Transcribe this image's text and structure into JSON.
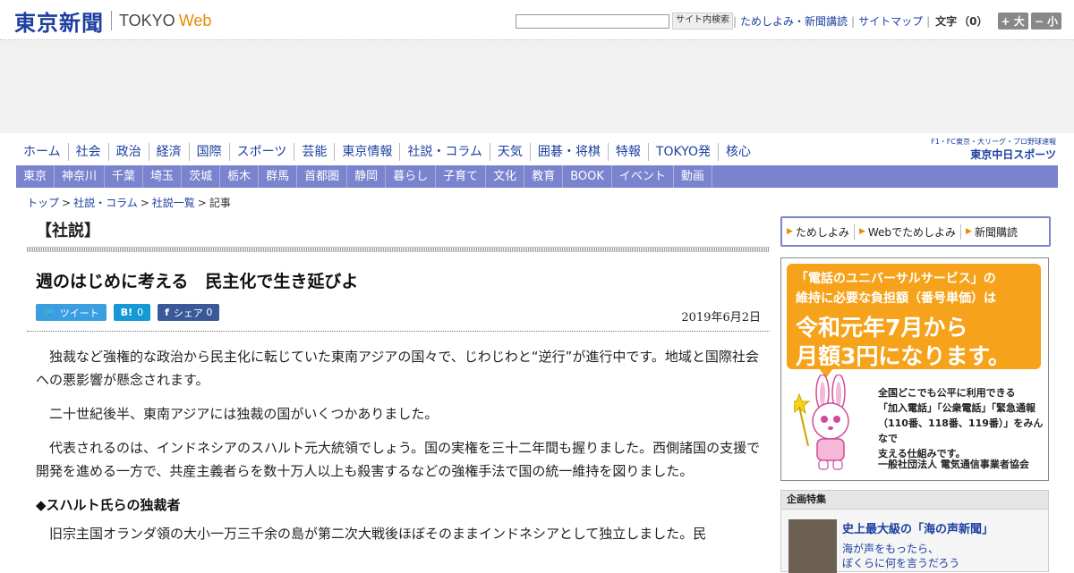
{
  "header": {
    "logo_jp": "東京新聞",
    "logo_en": "TOKYO",
    "logo_web": "Web",
    "search_button": "サイト内検索",
    "links": [
      "ためしよみ・新聞講読",
      "サイトマップ"
    ],
    "font_label": "文字",
    "font_count": "（0）",
    "font_plus": "+ 大",
    "font_minus": "− 小"
  },
  "nav_primary": [
    "ホーム",
    "社会",
    "政治",
    "経済",
    "国際",
    "スポーツ",
    "芸能",
    "東京情報",
    "社説・コラム",
    "天気",
    "囲碁・将棋",
    "特報",
    "TOKYO発",
    "核心"
  ],
  "chunichi": {
    "sub": "F1・FC東京・大リーグ・プロ野球速報",
    "main": "東京中日スポーツ"
  },
  "nav_regional": [
    "東京",
    "神奈川",
    "千葉",
    "埼玉",
    "茨城",
    "栃木",
    "群馬",
    "首都圏",
    "静岡",
    "暮らし",
    "子育て",
    "文化",
    "教育",
    "BOOK",
    "イベント",
    "動画"
  ],
  "breadcrumb": {
    "items": [
      "トップ",
      "社説・コラム",
      "社説一覧"
    ],
    "current": "記事"
  },
  "article": {
    "section": "【社説】",
    "title": "週のはじめに考える　民主化で生き延びよ",
    "share": {
      "tweet": "ツイート",
      "hatena_icon": "B!",
      "hatena_count": "0",
      "facebook": "シェア",
      "facebook_count": "0"
    },
    "date": "2019年6月2日",
    "p1": "独裁など強権的な政治から民主化に転じていた東南アジアの国々で、じわじわと“逆行”が進行中です。地域と国際社会への悪影響が懸念されます。",
    "p2": "二十世紀後半、東南アジアには独裁の国がいくつかありました。",
    "p3": "代表されるのは、インドネシアのスハルト元大統領でしょう。国の実権を三十二年間も握りました。西側諸国の支援で開発を進める一方で、共産主義者らを数十万人以上も殺害するなどの強権手法で国の統一維持を図りました。",
    "subhead": "◆スハルト氏らの独裁者",
    "p4": "旧宗主国オランダ領の大小一万三千余の島が第二次大戦後ほぼそのままインドネシアとして独立しました。民"
  },
  "subscribe": [
    "ためしよみ",
    "Webでためしよみ",
    "新聞購読"
  ],
  "ad_universal": {
    "l1": "「電話のユニバーサルサービス」の",
    "l2": "維持に必要な負担額（番号単価）は",
    "l3": "令和元年7月から",
    "l4": "月額3円になります。",
    "t1": "全国どこでも公平に利用できる",
    "t2": "「加入電話」「公衆電話」「緊急通報",
    "t3": "（110番、118番、119番）」をみんなで",
    "t4": "支える仕組みです。",
    "org": "一般社団法人 電気通信事業者協会"
  },
  "special": {
    "heading": "企画特集",
    "title": "史上最大級の「海の声新聞」",
    "l1": "海が声をもったら、",
    "l2": "ぼくらに何を言うだろう"
  },
  "colors": {
    "brand": "#1c3fa0",
    "nav_bar": "#7a83cd",
    "accent": "#e98a00"
  }
}
